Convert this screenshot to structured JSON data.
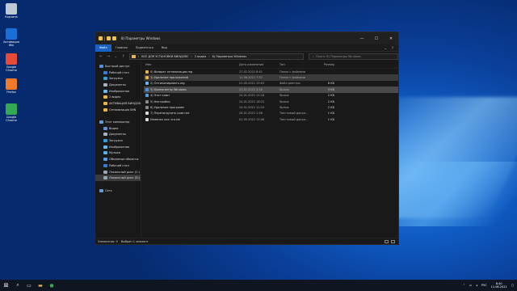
{
  "desktop": {
    "icons": [
      {
        "label": "Корзина",
        "color": "#bfc9d6"
      },
      {
        "label": "Активация Win",
        "color": "#1a6fd6"
      },
      {
        "label": "Google Chrome",
        "color": "#e84a3a"
      },
      {
        "label": "Firefox",
        "color": "#f17a2a"
      },
      {
        "label": "Google Chrome",
        "color": "#34a853"
      }
    ]
  },
  "window": {
    "title": "8) Параметры Windows",
    "ribbon": {
      "file": "Файл",
      "home": "Главная",
      "share": "Поделиться",
      "view": "Вид"
    },
    "address": {
      "path": [
        "ВСЕ ДЛЯ УСТАНОВКИ ВИНДОВС",
        "2 видео",
        "8) Параметры Windows"
      ],
      "search_placeholder": "Поиск: 8) Параметры Windows"
    },
    "sidebar": [
      {
        "label": "Быстрый доступ",
        "color": "#4a90e2"
      },
      {
        "label": "Рабочий стол",
        "color": "#3a7bd5"
      },
      {
        "label": "Загрузки",
        "color": "#3a9bd5"
      },
      {
        "label": "Документы",
        "color": "#aab4c0"
      },
      {
        "label": "Изображения",
        "color": "#6bb7e8"
      },
      {
        "label": "2 видео",
        "color": "#e8b64a"
      },
      {
        "label": "АКТИВАЦИЯ ВИНДОВС",
        "color": "#e8b64a"
      },
      {
        "label": "Оптимизация WIN",
        "color": "#e8b64a"
      },
      {
        "label": "",
        "color": "#191919"
      },
      {
        "label": "Этот компьютер",
        "color": "#5aa0e0"
      },
      {
        "label": "Видео",
        "color": "#6a8fd0"
      },
      {
        "label": "Документы",
        "color": "#aab4c0"
      },
      {
        "label": "Загрузки",
        "color": "#3a9bd5"
      },
      {
        "label": "Изображения",
        "color": "#6bb7e8"
      },
      {
        "label": "Музыка",
        "color": "#5ab0e8"
      },
      {
        "label": "Объемные объекты",
        "color": "#5aa0e0"
      },
      {
        "label": "Рабочий стол",
        "color": "#3a7bd5"
      },
      {
        "label": "Локальный диск (C:)",
        "color": "#9aa6b4"
      },
      {
        "label": "Локальный диск (D:)",
        "color": "#9aa6b4"
      },
      {
        "label": "",
        "color": "#191919"
      },
      {
        "label": "Сеть",
        "color": "#5aa0e0"
      }
    ],
    "columns": {
      "name": "Имя",
      "date": "Дата изменения",
      "type": "Тип",
      "size": "Размер"
    },
    "files": [
      {
        "name": "0) Возврат оптимизации.reg",
        "date": "27.02.2021 8:41",
        "type": "Папка с файлами",
        "size": "",
        "color": "#e8b64a"
      },
      {
        "name": "1) Удаление приложений",
        "date": "11.06.2021 7:37",
        "type": "Папка с файлами",
        "size": "",
        "color": "#e8b64a"
      },
      {
        "name": "2) Оптимизировать.reg",
        "date": "01.05.2021 15:03",
        "type": "Файл реестра",
        "size": "8 КБ",
        "color": "#6bb7e8"
      },
      {
        "name": "3) Компоненты Windows",
        "date": "22.01.2021 2:16",
        "type": "Ярлык",
        "size": "3 КБ",
        "color": "#4a90e2"
      },
      {
        "name": "4) Этот комп",
        "date": "24.01.2021 12:18",
        "type": "Ярлык",
        "size": "2 КБ",
        "color": "#5aa0e0"
      },
      {
        "name": "5) Настройки",
        "date": "24.01.2021 16:31",
        "type": "Ярлык",
        "size": "2 КБ",
        "color": "#8a8a8a"
      },
      {
        "name": "6) Удаление программ",
        "date": "24.01.2021 12:19",
        "type": "Ярлык",
        "size": "2 КБ",
        "color": "#8a8a8a"
      },
      {
        "name": "7) Перезагрузить комп.txt",
        "date": "28.01.2021 1:46",
        "type": "Текстовый докум...",
        "size": "1 КБ",
        "color": "#dddddd"
      },
      {
        "name": "Изменил кое что.txt",
        "date": "01.05.2021 15:06",
        "type": "Текстовый докум...",
        "size": "1 КБ",
        "color": "#dddddd"
      }
    ],
    "status": {
      "count": "Элементов: 9",
      "selected": "Выбран 1 элемент"
    }
  },
  "taskbar": {
    "lang": "РУС",
    "time": "8:40",
    "date": "11.06.2021"
  }
}
